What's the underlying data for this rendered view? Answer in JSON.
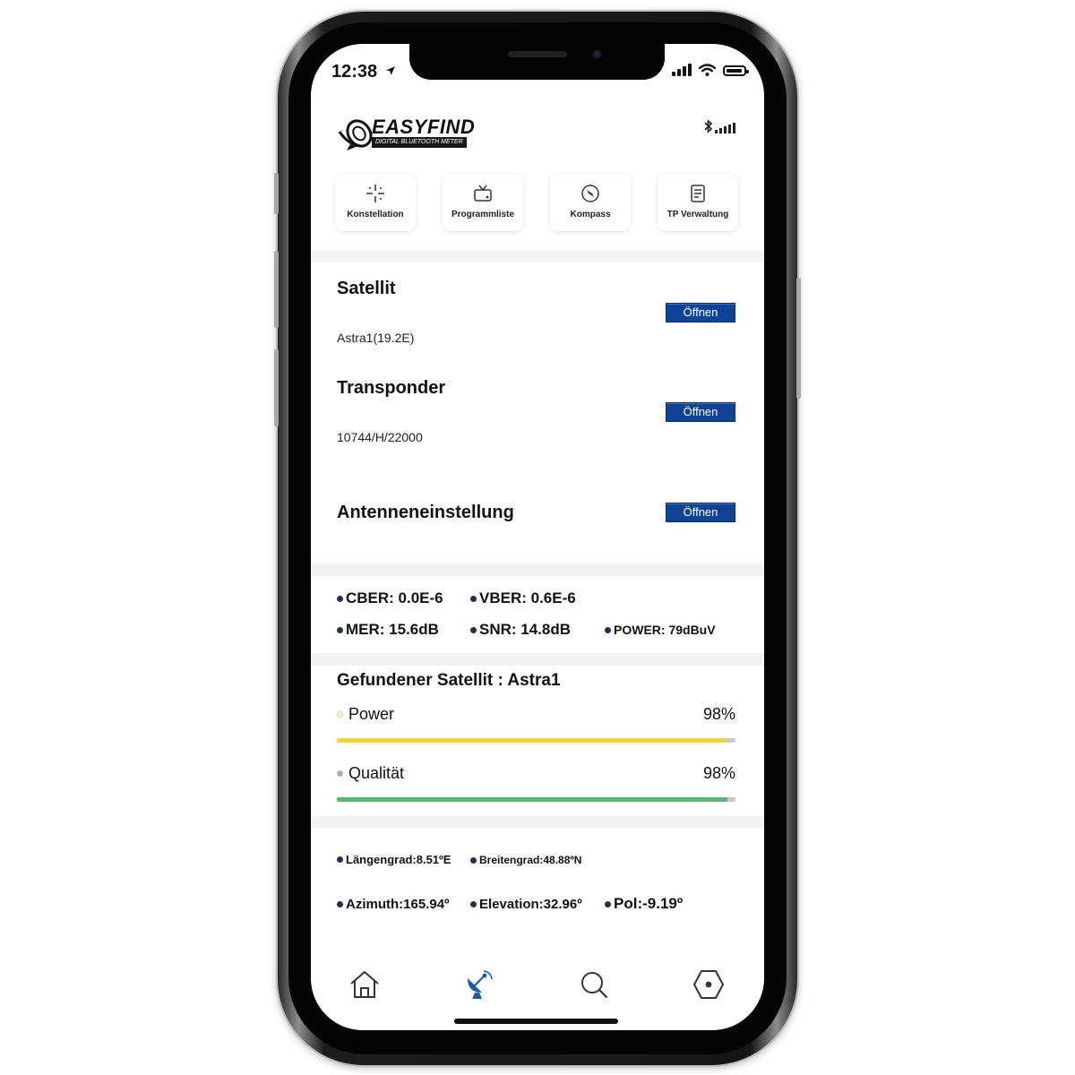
{
  "status_bar": {
    "time": "12:38"
  },
  "header": {
    "brand": "EASYFIND",
    "tagline": "DIGITAL BLUETOOTH METER"
  },
  "quick_actions": [
    {
      "label": "Konstellation",
      "icon": "constellation-icon"
    },
    {
      "label": "Programmliste",
      "icon": "tv-icon"
    },
    {
      "label": "Kompass",
      "icon": "compass-icon"
    },
    {
      "label": "TP Verwaltung",
      "icon": "document-icon"
    }
  ],
  "satellite": {
    "title": "Satellit",
    "value": "Astra1(19.2E)",
    "button": "Öffnen"
  },
  "transponder": {
    "title": "Transponder",
    "value": "10744/H/22000",
    "button": "Öffnen"
  },
  "antenna": {
    "title": "Antenneneinstellung",
    "button": "Öffnen"
  },
  "metrics": {
    "cber": "CBER: 0.0E-6",
    "vber": "VBER: 0.6E-6",
    "mer": "MER: 15.6dB",
    "snr": "SNR: 14.8dB",
    "power": "POWER: 79dBuV"
  },
  "signal": {
    "title": "Gefundener Satellit : Astra1",
    "power": {
      "label": "Power",
      "percent_text": "98%",
      "percent": 98,
      "color": "#f0d43a",
      "dot_color": "#c9d56a"
    },
    "quality": {
      "label": "Qualität",
      "percent_text": "98%",
      "percent": 98,
      "color": "#5cb870",
      "dot_color": "#a9b0b4"
    }
  },
  "geo": {
    "longitude": "Längengrad:8.51ºE",
    "latitude": "Breitengrad:48.88ºN",
    "azimuth": "Azimuth:165.94º",
    "elevation": "Elevation:32.96º",
    "pol": "Pol:-9.19º"
  },
  "tabbar": {
    "tabs": [
      {
        "name": "home",
        "icon": "home-icon",
        "active": false
      },
      {
        "name": "satellite",
        "icon": "satellite-dish-icon",
        "active": true
      },
      {
        "name": "search",
        "icon": "search-icon",
        "active": false
      },
      {
        "name": "settings",
        "icon": "hexagon-settings-icon",
        "active": false
      }
    ],
    "active_color": "#1d5aa8"
  }
}
